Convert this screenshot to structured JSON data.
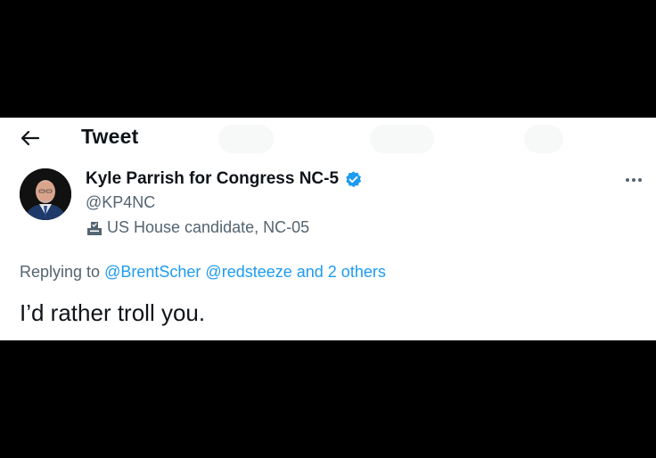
{
  "header": {
    "title": "Tweet",
    "back_icon": "arrow-left-icon"
  },
  "author": {
    "name": "Kyle Parrish for Congress NC-5",
    "handle": "@KP4NC",
    "bio_icon": "ballot-box-icon",
    "bio": "US House candidate, NC-05",
    "verified_icon": "verified-badge-icon",
    "verified_color": "#1d9bf0"
  },
  "more_icon": "more-horizontal-icon",
  "reply_context": {
    "prefix": "Replying to",
    "users": [
      "@BrentScher",
      "@redsteeze"
    ],
    "others": "and 2 others"
  },
  "tweet": {
    "text": "I’d rather troll you."
  },
  "colors": {
    "text_primary": "#0f1419",
    "text_secondary": "#536471",
    "link": "#1d9bf0",
    "background": "#ffffff",
    "letterbox": "#000000"
  }
}
